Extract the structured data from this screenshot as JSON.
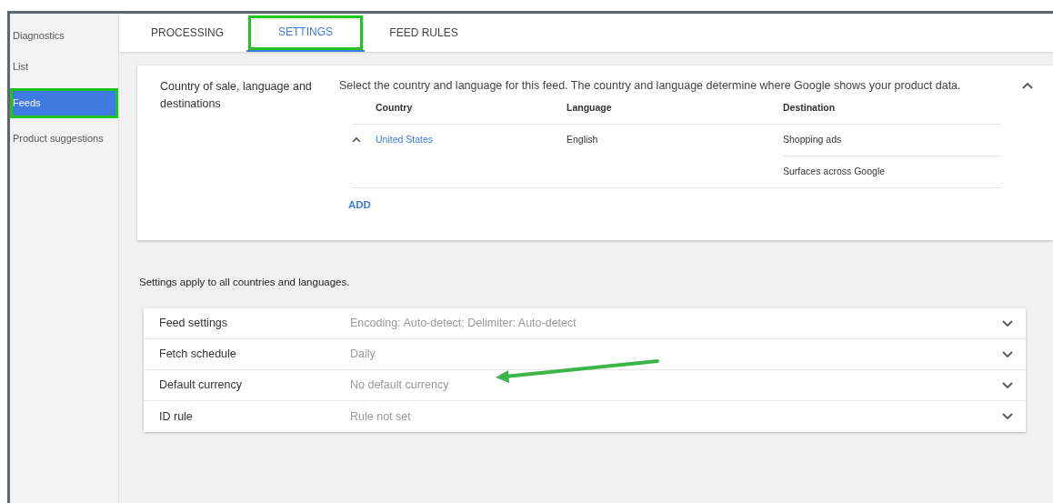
{
  "sidebar": {
    "items": [
      {
        "label": "Diagnostics",
        "selected": false,
        "highlighted": false
      },
      {
        "label": "List",
        "selected": false,
        "highlighted": false
      },
      {
        "label": "Feeds",
        "selected": true,
        "highlighted": true
      },
      {
        "label": "Product suggestions",
        "selected": false,
        "highlighted": false
      }
    ]
  },
  "tabs": [
    {
      "label": "PROCESSING",
      "selected": false,
      "highlighted": false
    },
    {
      "label": "SETTINGS",
      "selected": true,
      "highlighted": true
    },
    {
      "label": "FEED RULES",
      "selected": false,
      "highlighted": false
    }
  ],
  "country_section": {
    "title": "Country of sale, language and destinations",
    "description": "Select the country and language for this feed. The country and language determine where Google shows your product data.",
    "expanded": true,
    "columns": [
      "Country",
      "Language",
      "Destination"
    ],
    "rows": [
      {
        "country": "United States",
        "language": "English",
        "destinations": [
          "Shopping ads",
          "Surfaces across Google"
        ],
        "expanded": true
      }
    ],
    "add_label": "ADD"
  },
  "settings_note": "Settings apply to all countries and languages.",
  "settings": [
    {
      "label": "Feed settings",
      "value": "Encoding: Auto-detect; Delimiter: Auto-detect",
      "expanded": false
    },
    {
      "label": "Fetch schedule",
      "value": "Daily",
      "expanded": false
    },
    {
      "label": "Default currency",
      "value": "No default currency",
      "expanded": false,
      "pointed_at": true
    },
    {
      "label": "ID rule",
      "value": "Rule not set",
      "expanded": false
    }
  ]
}
